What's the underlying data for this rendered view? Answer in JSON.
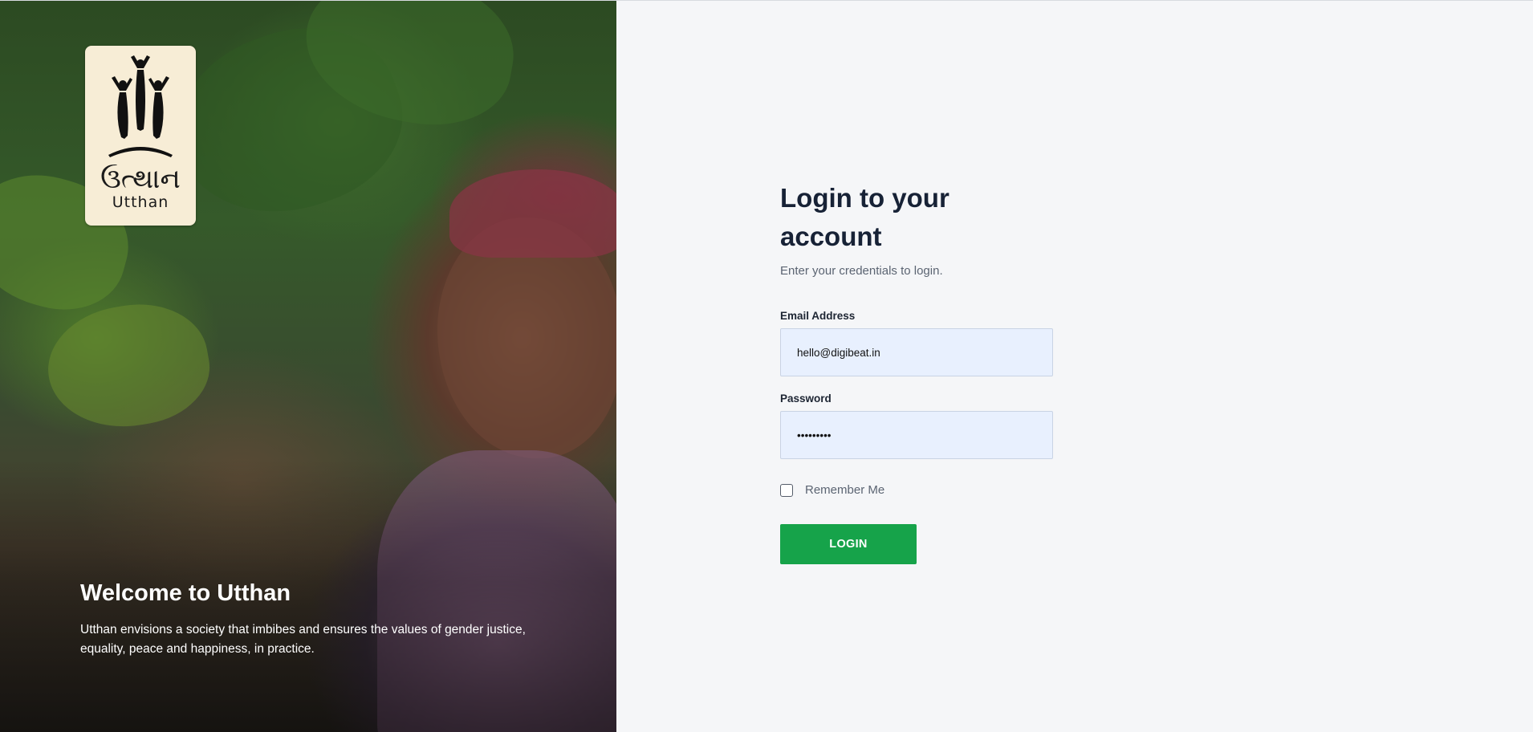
{
  "hero": {
    "logo_script": "ઉત્થાન",
    "logo_word": "Utthan",
    "title": "Welcome to Utthan",
    "description": "Utthan envisions a society that imbibes and ensures the values of gender justice, equality, peace and happiness, in practice."
  },
  "login": {
    "title": "Login to your account",
    "subtitle": "Enter your credentials to login.",
    "email_label": "Email Address",
    "email_value": "hello@digibeat.in",
    "password_label": "Password",
    "password_value": "•••••••••",
    "remember_label": "Remember Me",
    "remember_checked": false,
    "button_label": "LOGIN"
  },
  "colors": {
    "primary_button": "#16a34a",
    "heading": "#172236",
    "form_background": "#f5f6f8",
    "input_background": "#e8f0fe"
  }
}
